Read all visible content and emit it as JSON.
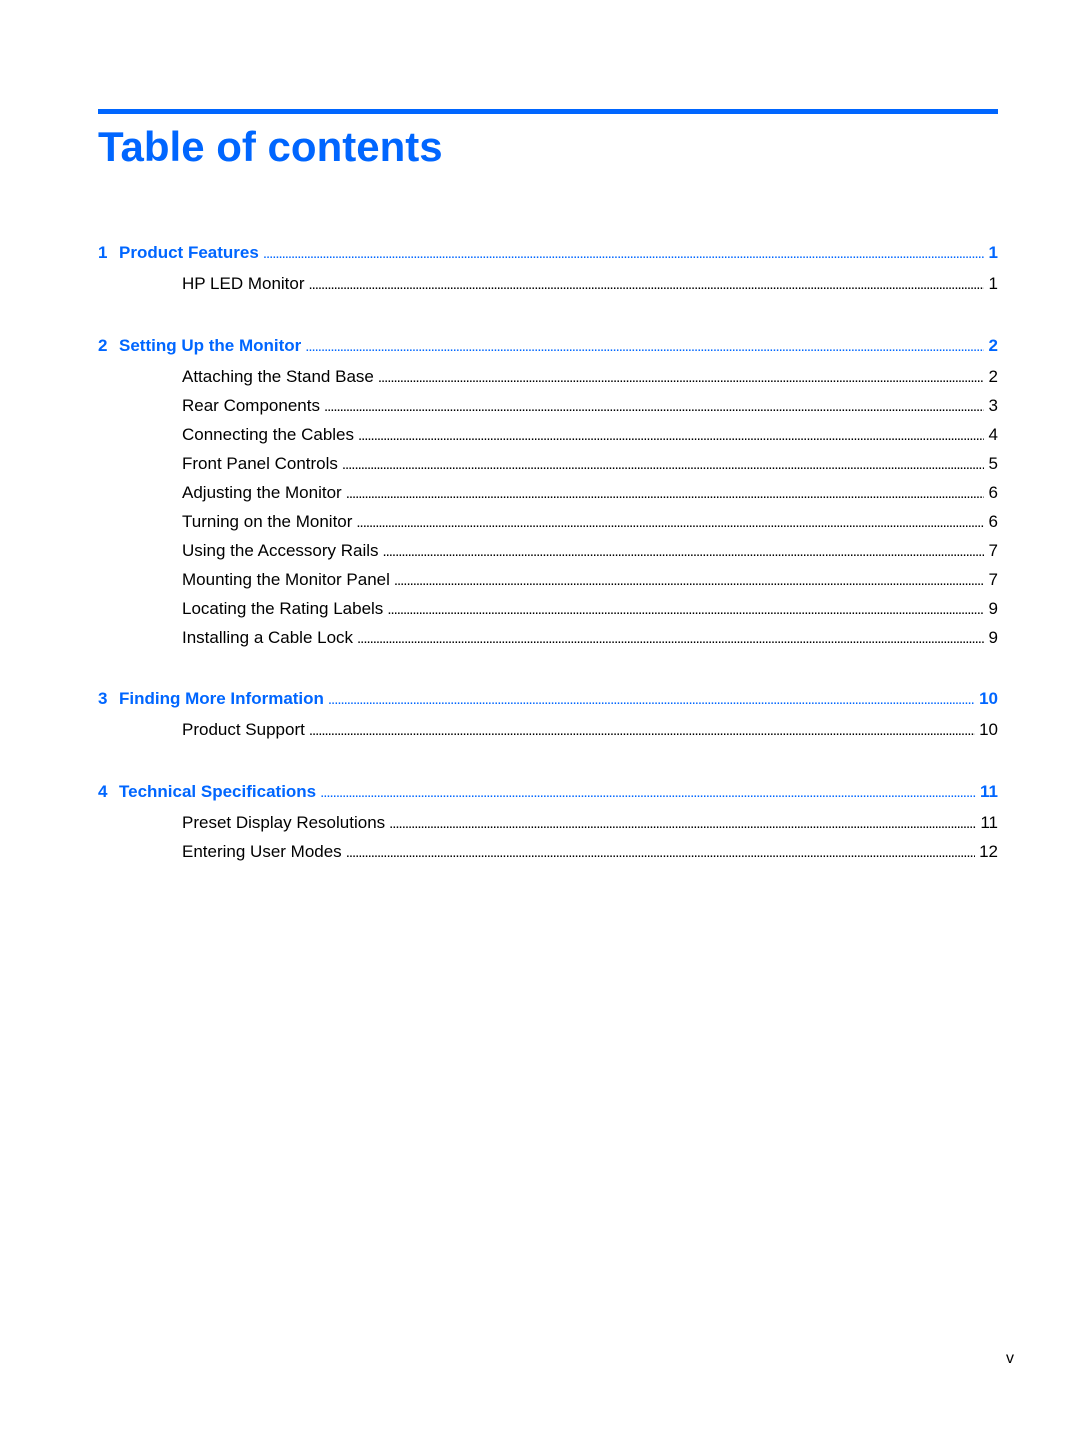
{
  "page": {
    "title": "Table of contents",
    "footer_page": "v",
    "accent_color": "#0066ff"
  },
  "toc": [
    {
      "number": "1",
      "title": "Product Features",
      "page": "1",
      "sections": [
        {
          "title": "HP LED Monitor",
          "page": "1"
        }
      ]
    },
    {
      "number": "2",
      "title": "Setting Up the Monitor",
      "page": "2",
      "sections": [
        {
          "title": "Attaching the Stand Base",
          "page": "2"
        },
        {
          "title": "Rear Components",
          "page": "3"
        },
        {
          "title": "Connecting the Cables",
          "page": "4"
        },
        {
          "title": "Front Panel Controls",
          "page": "5"
        },
        {
          "title": "Adjusting the Monitor",
          "page": "6"
        },
        {
          "title": "Turning on the Monitor",
          "page": "6"
        },
        {
          "title": "Using the Accessory Rails",
          "page": "7"
        },
        {
          "title": "Mounting the Monitor Panel",
          "page": "7"
        },
        {
          "title": "Locating the Rating Labels",
          "page": "9"
        },
        {
          "title": "Installing a Cable Lock",
          "page": "9"
        }
      ]
    },
    {
      "number": "3",
      "title": "Finding More Information",
      "page": "10",
      "sections": [
        {
          "title": "Product Support",
          "page": "10"
        }
      ]
    },
    {
      "number": "4",
      "title": "Technical Specifications",
      "page": "11",
      "sections": [
        {
          "title": "Preset Display Resolutions",
          "page": "11"
        },
        {
          "title": "Entering User Modes",
          "page": "12"
        }
      ]
    }
  ]
}
